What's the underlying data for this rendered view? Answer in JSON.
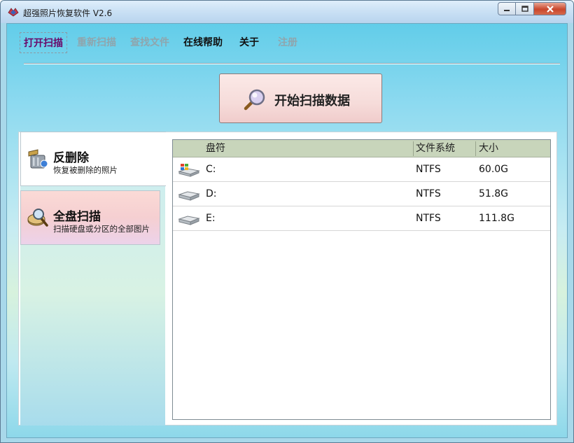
{
  "window": {
    "title": "超强照片恢复软件 V2.6",
    "controls": {
      "minimize": "0",
      "maximize": "□",
      "close": "x"
    }
  },
  "menu": {
    "items": [
      {
        "label": "打开扫描",
        "state": "active"
      },
      {
        "label": "重新扫描",
        "state": "disabled"
      },
      {
        "label": "查找文件",
        "state": "disabled"
      },
      {
        "label": "在线帮助",
        "state": "normal"
      },
      {
        "label": "关于",
        "state": "normal"
      },
      {
        "label": "注册",
        "state": "disabled"
      }
    ]
  },
  "scan_button": {
    "label": "开始扫描数据",
    "icon": "magnifier-icon"
  },
  "modes": [
    {
      "title": "反删除",
      "subtitle": "恢复被删除的照片",
      "icon": "recycle-bin-icon",
      "selected": true
    },
    {
      "title": "全盘扫描",
      "subtitle": "扫描硬盘或分区的全部图片",
      "icon": "disk-scan-icon",
      "selected": false
    }
  ],
  "drive_table": {
    "columns": [
      "盘符",
      "文件系统",
      "大小"
    ],
    "rows": [
      {
        "drive": "C:",
        "fs": "NTFS",
        "size": "60.0G",
        "icon": "windows-drive-icon"
      },
      {
        "drive": "D:",
        "fs": "NTFS",
        "size": "51.8G",
        "icon": "hard-drive-icon"
      },
      {
        "drive": "E:",
        "fs": "NTFS",
        "size": "111.8G",
        "icon": "hard-drive-icon"
      }
    ]
  },
  "colors": {
    "menu_active": "#6a0a6a",
    "menu_disabled": "#8fa5ad",
    "header_bg": "#c8d5bb",
    "scan_button_bg": "#f6dcda"
  }
}
